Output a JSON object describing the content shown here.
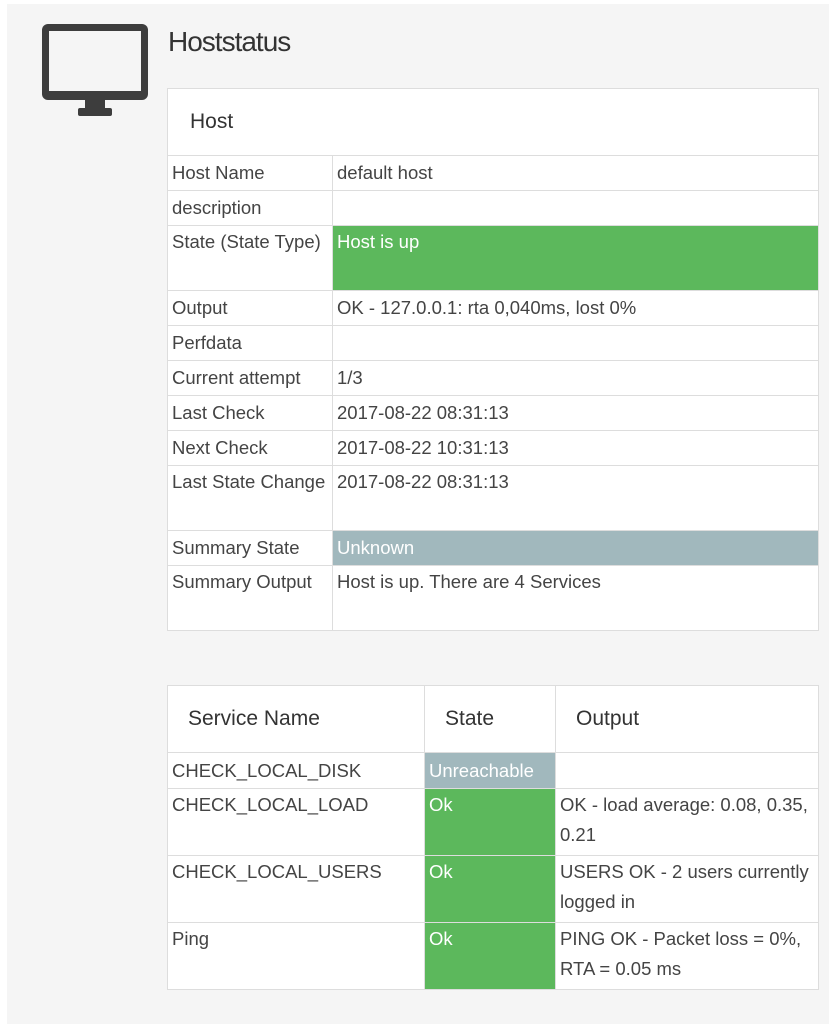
{
  "page": {
    "title": "Hoststatus",
    "icon": "monitor-icon"
  },
  "colors": {
    "ok": "#5cb85c",
    "unknown": "#a1b8bd",
    "icon": "#3d3d3d"
  },
  "host_table": {
    "header": "Host",
    "rows": [
      {
        "label": "Host Name",
        "value": "default host"
      },
      {
        "label": "description",
        "value": ""
      },
      {
        "label": "State (State Type)",
        "value": "Host is up",
        "status": "ok"
      },
      {
        "label": "Output",
        "value": "OK - 127.0.0.1: rta 0,040ms, lost 0%"
      },
      {
        "label": "Perfdata",
        "value": ""
      },
      {
        "label": "Current attempt",
        "value": "1/3"
      },
      {
        "label": "Last Check",
        "value": "2017-08-22 08:31:13"
      },
      {
        "label": "Next Check",
        "value": "2017-08-22 10:31:13"
      },
      {
        "label": "Last State Change",
        "value": "2017-08-22 08:31:13"
      },
      {
        "label": "Summary State",
        "value": "Unknown",
        "status": "unknown"
      },
      {
        "label": "Summary Output",
        "value": "Host is up. There are 4 Services"
      }
    ]
  },
  "services_table": {
    "headers": [
      "Service Name",
      "State",
      "Output"
    ],
    "rows": [
      {
        "name": "CHECK_LOCAL_DISK",
        "state": "Unreachable",
        "output": ""
      },
      {
        "name": "CHECK_LOCAL_LOAD",
        "state": "Ok",
        "output": "OK - load average: 0.08, 0.35, 0.21"
      },
      {
        "name": "CHECK_LOCAL_USERS",
        "state": "Ok",
        "output": "USERS OK - 2 users currently logged in"
      },
      {
        "name": "Ping",
        "state": "Ok",
        "output": "PING OK - Packet loss = 0%, RTA = 0.05 ms"
      }
    ]
  }
}
